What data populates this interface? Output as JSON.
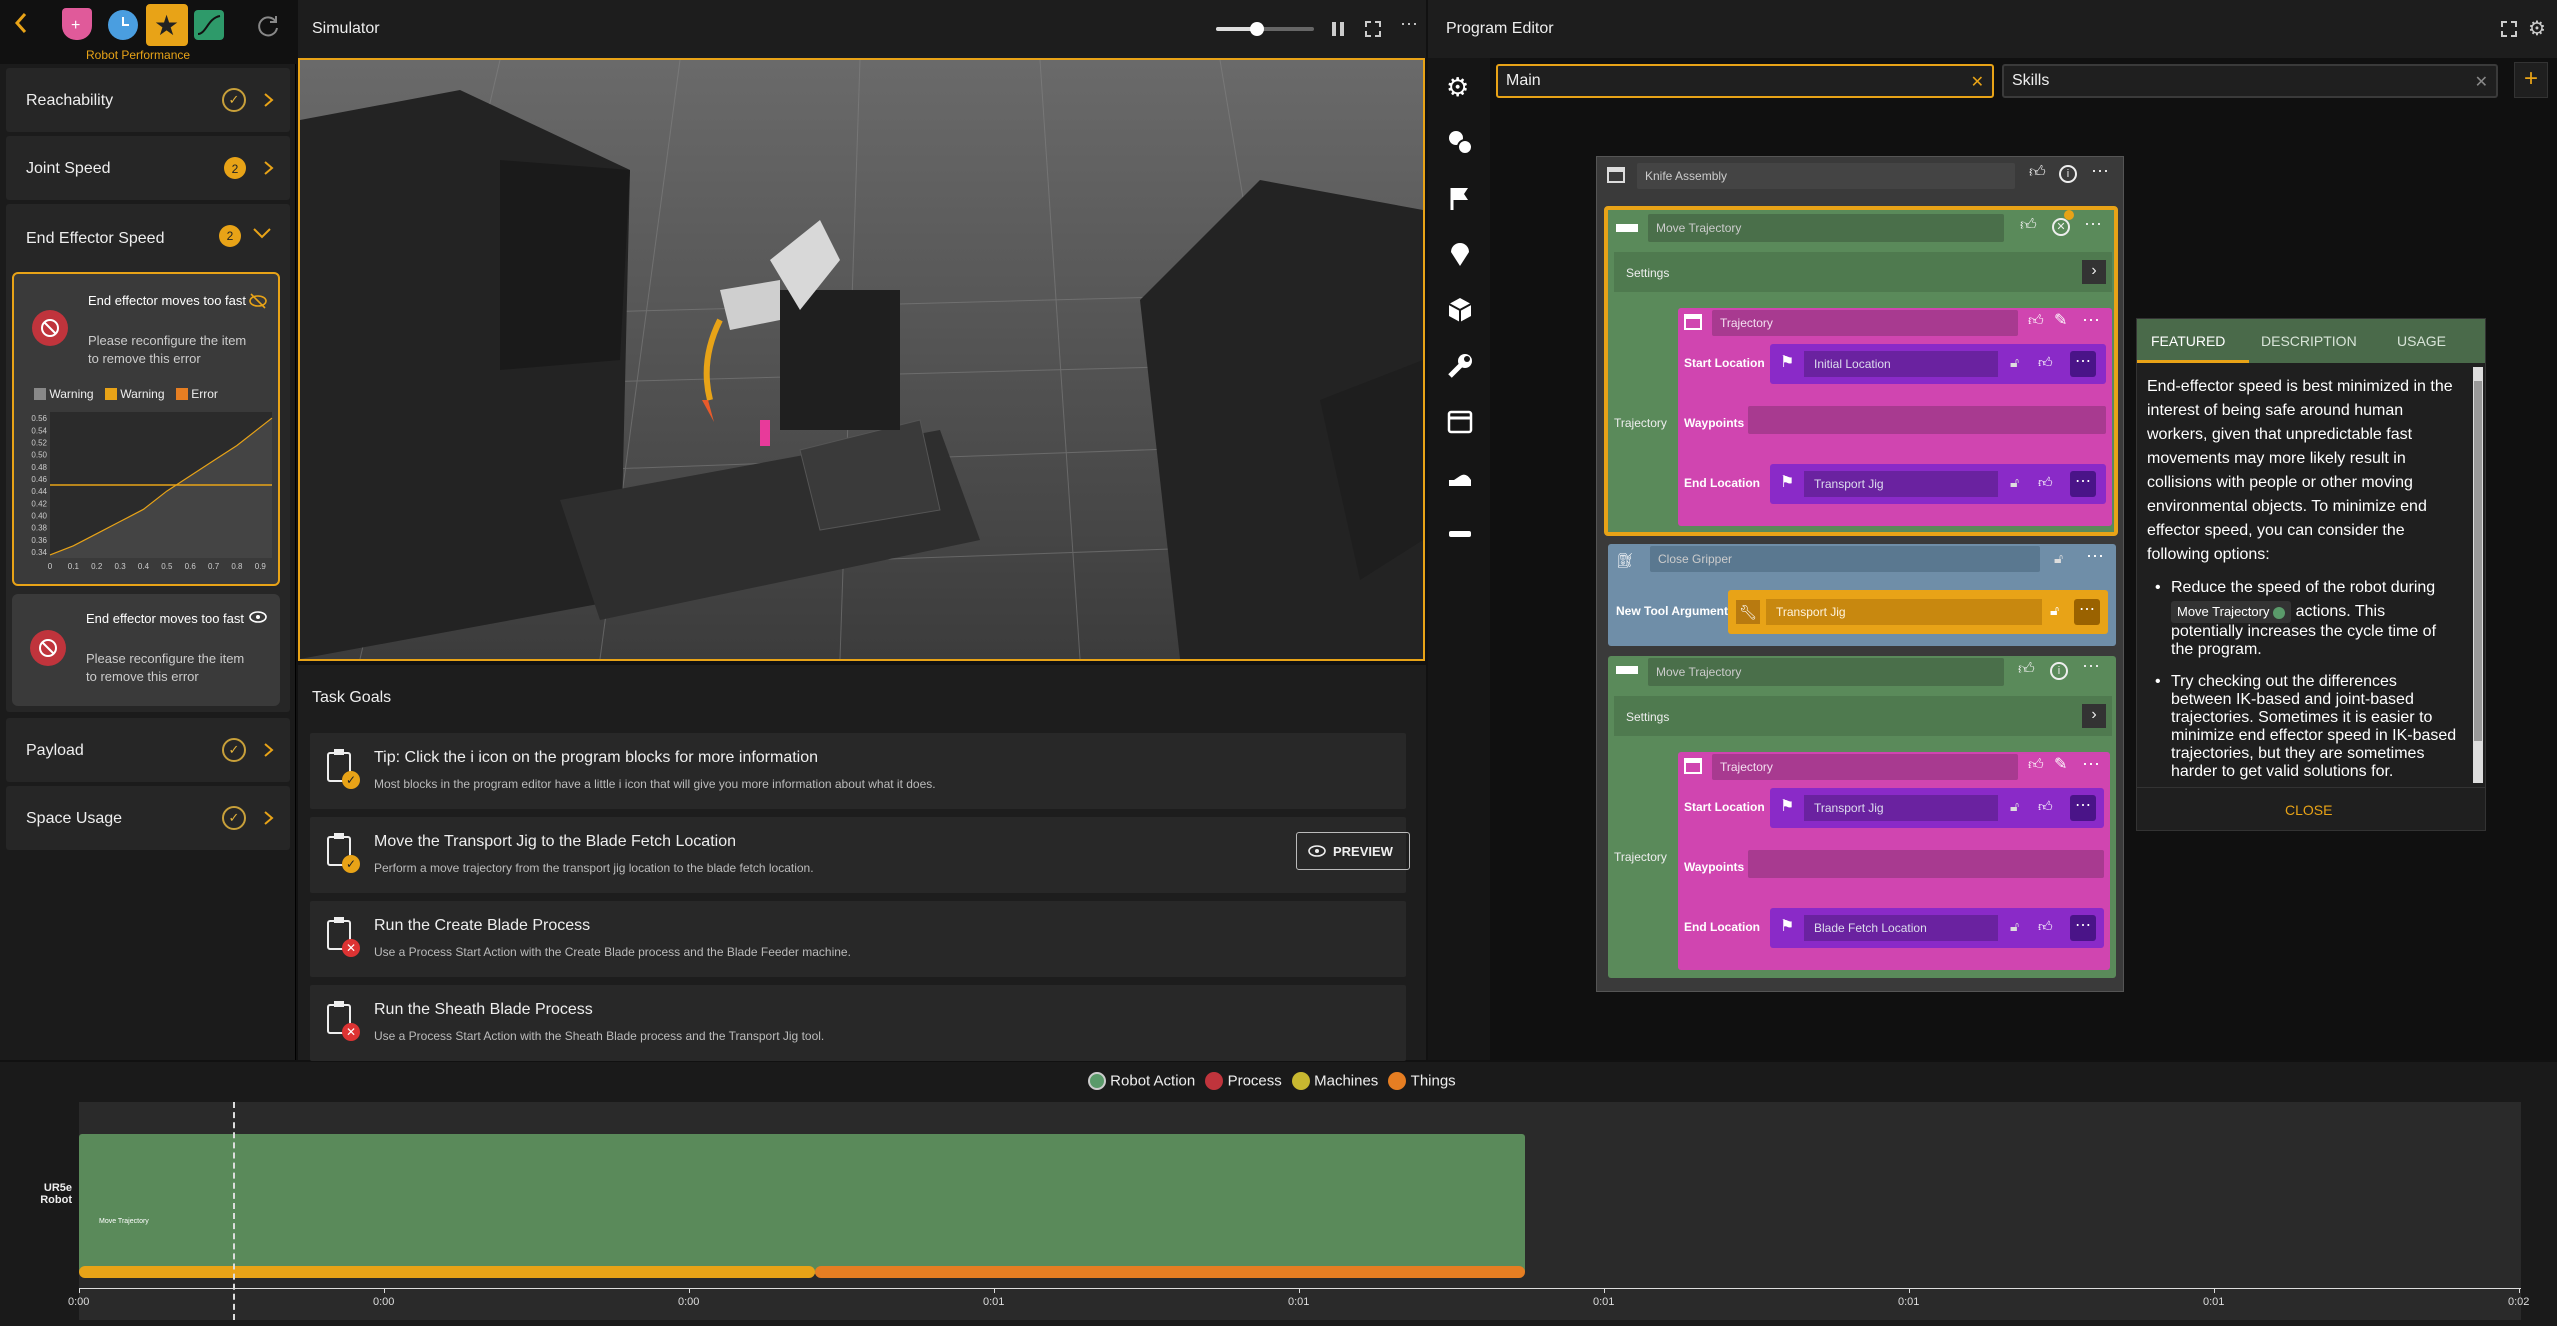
{
  "left_panel": {
    "top_caption": "Robot Performance",
    "items": [
      {
        "label": "Reachability",
        "status": "ok"
      },
      {
        "label": "Joint Speed",
        "status": "2"
      },
      {
        "label": "End Effector Speed",
        "status": "2"
      },
      {
        "label": "Payload",
        "status": "ok"
      },
      {
        "label": "Space Usage",
        "status": "ok"
      }
    ],
    "error_cards": [
      {
        "title": "End effector moves too fast",
        "body": "Please reconfigure the item to remove this error"
      },
      {
        "title": "End effector moves too fast",
        "body": "Please reconfigure the item to remove this error"
      }
    ],
    "mini_chart": {
      "legend": [
        "Warning",
        "Warning",
        "Error"
      ],
      "colors": {
        "warning_gray": "#888888",
        "warning_orange": "#e8a317",
        "error": "#e67e22"
      }
    }
  },
  "chart_data": {
    "type": "line",
    "title": "",
    "xlabel": "",
    "ylabel": "",
    "x_ticks": [
      "0",
      "0.1",
      "0.2",
      "0.3",
      "0.4",
      "0.5",
      "0.6",
      "0.7",
      "0.8",
      "0.9"
    ],
    "y_ticks": [
      "0.56",
      "0.54",
      "0.52",
      "0.50",
      "0.48",
      "0.46",
      "0.44",
      "0.42",
      "0.40",
      "0.38",
      "0.36",
      "0.34"
    ],
    "xlim": [
      0,
      0.95
    ],
    "ylim": [
      0.33,
      0.57
    ],
    "series": [
      {
        "values": [
          [
            0,
            0.335
          ],
          [
            0.1,
            0.35
          ],
          [
            0.2,
            0.37
          ],
          [
            0.3,
            0.39
          ],
          [
            0.4,
            0.41
          ],
          [
            0.5,
            0.44
          ],
          [
            0.6,
            0.465
          ],
          [
            0.7,
            0.49
          ],
          [
            0.8,
            0.515
          ],
          [
            0.9,
            0.545
          ],
          [
            0.95,
            0.56
          ]
        ]
      }
    ],
    "threshold": 0.45
  },
  "simulator": {
    "title": "Simulator",
    "zoom_fraction": 0.42
  },
  "task_goals": {
    "title": "Task Goals",
    "items": [
      {
        "title": "Tip: Click the i icon on the program blocks for more information",
        "desc": "Most blocks in the program editor have a little i icon that will give you more information about what it does.",
        "status": "done"
      },
      {
        "title": "Move the Transport Jig to the Blade Fetch Location",
        "desc": "Perform a move trajectory from the transport jig location to the blade fetch location.",
        "status": "done",
        "action": "PREVIEW"
      },
      {
        "title": "Run the Create Blade Process",
        "desc": "Use a Process Start Action with the Create Blade process and the Blade Feeder machine.",
        "status": "fail"
      },
      {
        "title": "Run the Sheath Blade Process",
        "desc": "Use a Process Start Action with the Sheath Blade process and the Transport Jig tool.",
        "status": "fail"
      }
    ]
  },
  "program_editor": {
    "title": "Program Editor",
    "tabs": [
      "Main",
      "Skills"
    ],
    "root_block": "Knife Assembly",
    "blocks": {
      "move1": "Move Trajectory",
      "settings": "Settings",
      "trajectory_label": "Trajectory",
      "trajectory": "Trajectory",
      "start_location": "Start Location",
      "initial_location": "Initial Location",
      "waypoints": "Waypoints",
      "end_location": "End Location",
      "transport_jig": "Transport Jig",
      "close_gripper": "Close Gripper",
      "new_tool_argument": "New Tool Argument",
      "move2": "Move Trajectory",
      "blade_fetch": "Blade Fetch Location"
    }
  },
  "featured": {
    "tabs": [
      "FEATURED",
      "DESCRIPTION",
      "USAGE"
    ],
    "paragraph": "End-effector speed is best minimized in the interest of being safe around human workers, given that unpredictable fast movements may more likely result in collisions with people or other moving environmental objects. To minimize end effector speed, you can consider the following options:",
    "bullet1_pre": "Reduce the speed of the robot during",
    "bullet1_chip": "Move Trajectory",
    "bullet1_post": "actions. This potentially increases the cycle time of the program.",
    "bullet2": "Try checking out the differences between IK-based and joint-based trajectories. Sometimes it is easier to minimize end effector speed in IK-based trajectories, but they are sometimes harder to get valid solutions for.",
    "close": "CLOSE"
  },
  "timeline": {
    "legend": [
      {
        "label": "Robot Action",
        "color": "#5a9a6a"
      },
      {
        "label": "Process",
        "color": "#c0343c"
      },
      {
        "label": "Machines",
        "color": "#c8b830"
      },
      {
        "label": "Things",
        "color": "#e67e22"
      }
    ],
    "row_label_1": "UR5e",
    "row_label_2": "Robot",
    "bar_label": "Move Trajectory",
    "ticks": [
      "0:00",
      "0:00",
      "0:00",
      "0:01",
      "0:01",
      "0:01",
      "0:01",
      "0:01",
      "0:02"
    ]
  }
}
